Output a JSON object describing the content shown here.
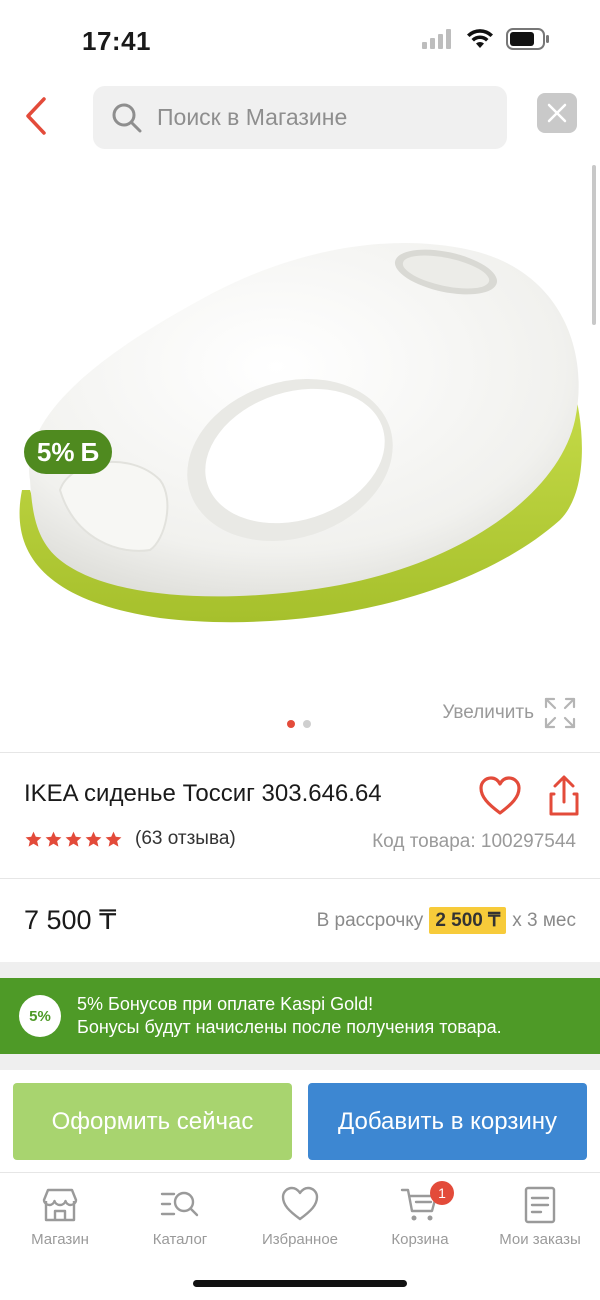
{
  "status_bar": {
    "time": "17:41"
  },
  "header": {
    "search_placeholder": "Поиск в Магазине"
  },
  "product": {
    "bonus_badge": "5%",
    "bonus_badge_symbol": "Б",
    "zoom_label": "Увеличить",
    "image_count": 2,
    "active_image": 0,
    "title": "IKEA сиденье Тоссиг 303.646.64",
    "rating": 5,
    "review_count": "(63 отзыва)",
    "sku": "Код товара: 100297544",
    "price": "7 500 ₸",
    "installment_prefix": "В рассрочку",
    "installment_amount": "2 500 ₸",
    "installment_suffix": "x 3 мес"
  },
  "bonus_banner": {
    "circle_label": "5%",
    "line1": "5% Бонусов при оплате Kaspi Gold!",
    "line2": "Бонусы будут начислены после получения товара."
  },
  "actions": {
    "checkout_label": "Оформить сейчас",
    "add_to_cart_label": "Добавить в корзину"
  },
  "tab_bar": {
    "tabs": [
      {
        "label": "Магазин",
        "icon": "store-icon"
      },
      {
        "label": "Каталог",
        "icon": "catalog-icon"
      },
      {
        "label": "Избранное",
        "icon": "heart-icon"
      },
      {
        "label": "Корзина",
        "icon": "cart-icon",
        "badge": "1"
      },
      {
        "label": "Мои заказы",
        "icon": "orders-icon"
      }
    ]
  },
  "colors": {
    "accent_red": "#e34b3a",
    "bonus_green": "#4e9a27",
    "checkout_green": "#a8d46f",
    "cart_blue": "#3d87d2",
    "installment_yellow": "#f7cb3a"
  }
}
